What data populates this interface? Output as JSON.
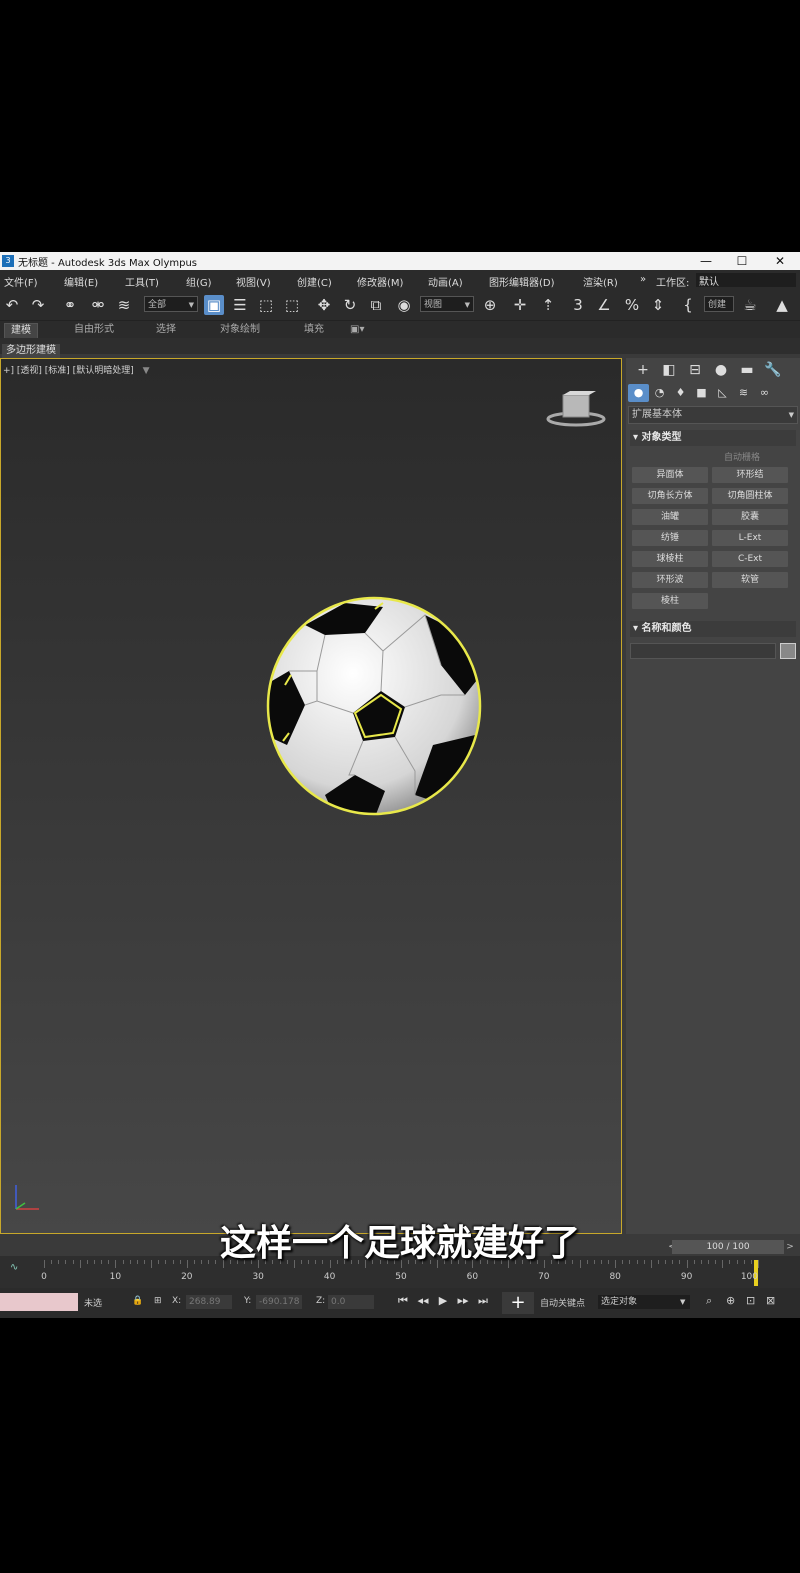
{
  "window": {
    "title": "无标题 - Autodesk 3ds Max Olympus",
    "app_icon": "3",
    "controls": [
      "—",
      "☐",
      "✕"
    ]
  },
  "menu": [
    "文件(F)",
    "编辑(E)",
    "工具(T)",
    "组(G)",
    "视图(V)",
    "创建(C)",
    "修改器(M)",
    "动画(A)",
    "图形编辑器(D)",
    "渲染(R)"
  ],
  "workspace": {
    "overflow": "»",
    "label": "工作区:",
    "value": "默认"
  },
  "toolbar": {
    "selection_filter": "全部",
    "ref_coord": "视图",
    "named_sel": "创建"
  },
  "ribbon": {
    "tabs": [
      "建模",
      "自由形式",
      "选择",
      "对象绘制",
      "填充"
    ],
    "active_tab": 0,
    "subtab": "多边形建模"
  },
  "viewport": {
    "label": "+] [透视] [标准] [默认明暗处理]",
    "selection_color": "#e8e84a",
    "border_color": "#c8a82a"
  },
  "command_panel": {
    "category": "扩展基本体",
    "rollout_object_type": "对象类型",
    "autogrid": "自动栅格",
    "object_buttons": [
      "异面体",
      "环形结",
      "切角长方体",
      "切角圆柱体",
      "油罐",
      "胶囊",
      "纺锤",
      "L-Ext",
      "球棱柱",
      "C-Ext",
      "环形波",
      "软管",
      "棱柱"
    ],
    "rollout_name_color": "名称和颜色"
  },
  "frame_counter": "100 / 100",
  "subtitle": "这样一个足球就建好了",
  "timeline": {
    "ticks": [
      "0",
      "10",
      "20",
      "30",
      "40",
      "50",
      "60",
      "70",
      "80",
      "90",
      "100"
    ],
    "current_frame": 100
  },
  "status": {
    "selected": "未选",
    "x_label": "X:",
    "x_value": "268.89",
    "y_label": "Y:",
    "y_value": "-690.178",
    "z_label": "Z:",
    "z_value": "0.0",
    "auto_key": "自动关键点",
    "set_key_filter": "选定对象"
  }
}
